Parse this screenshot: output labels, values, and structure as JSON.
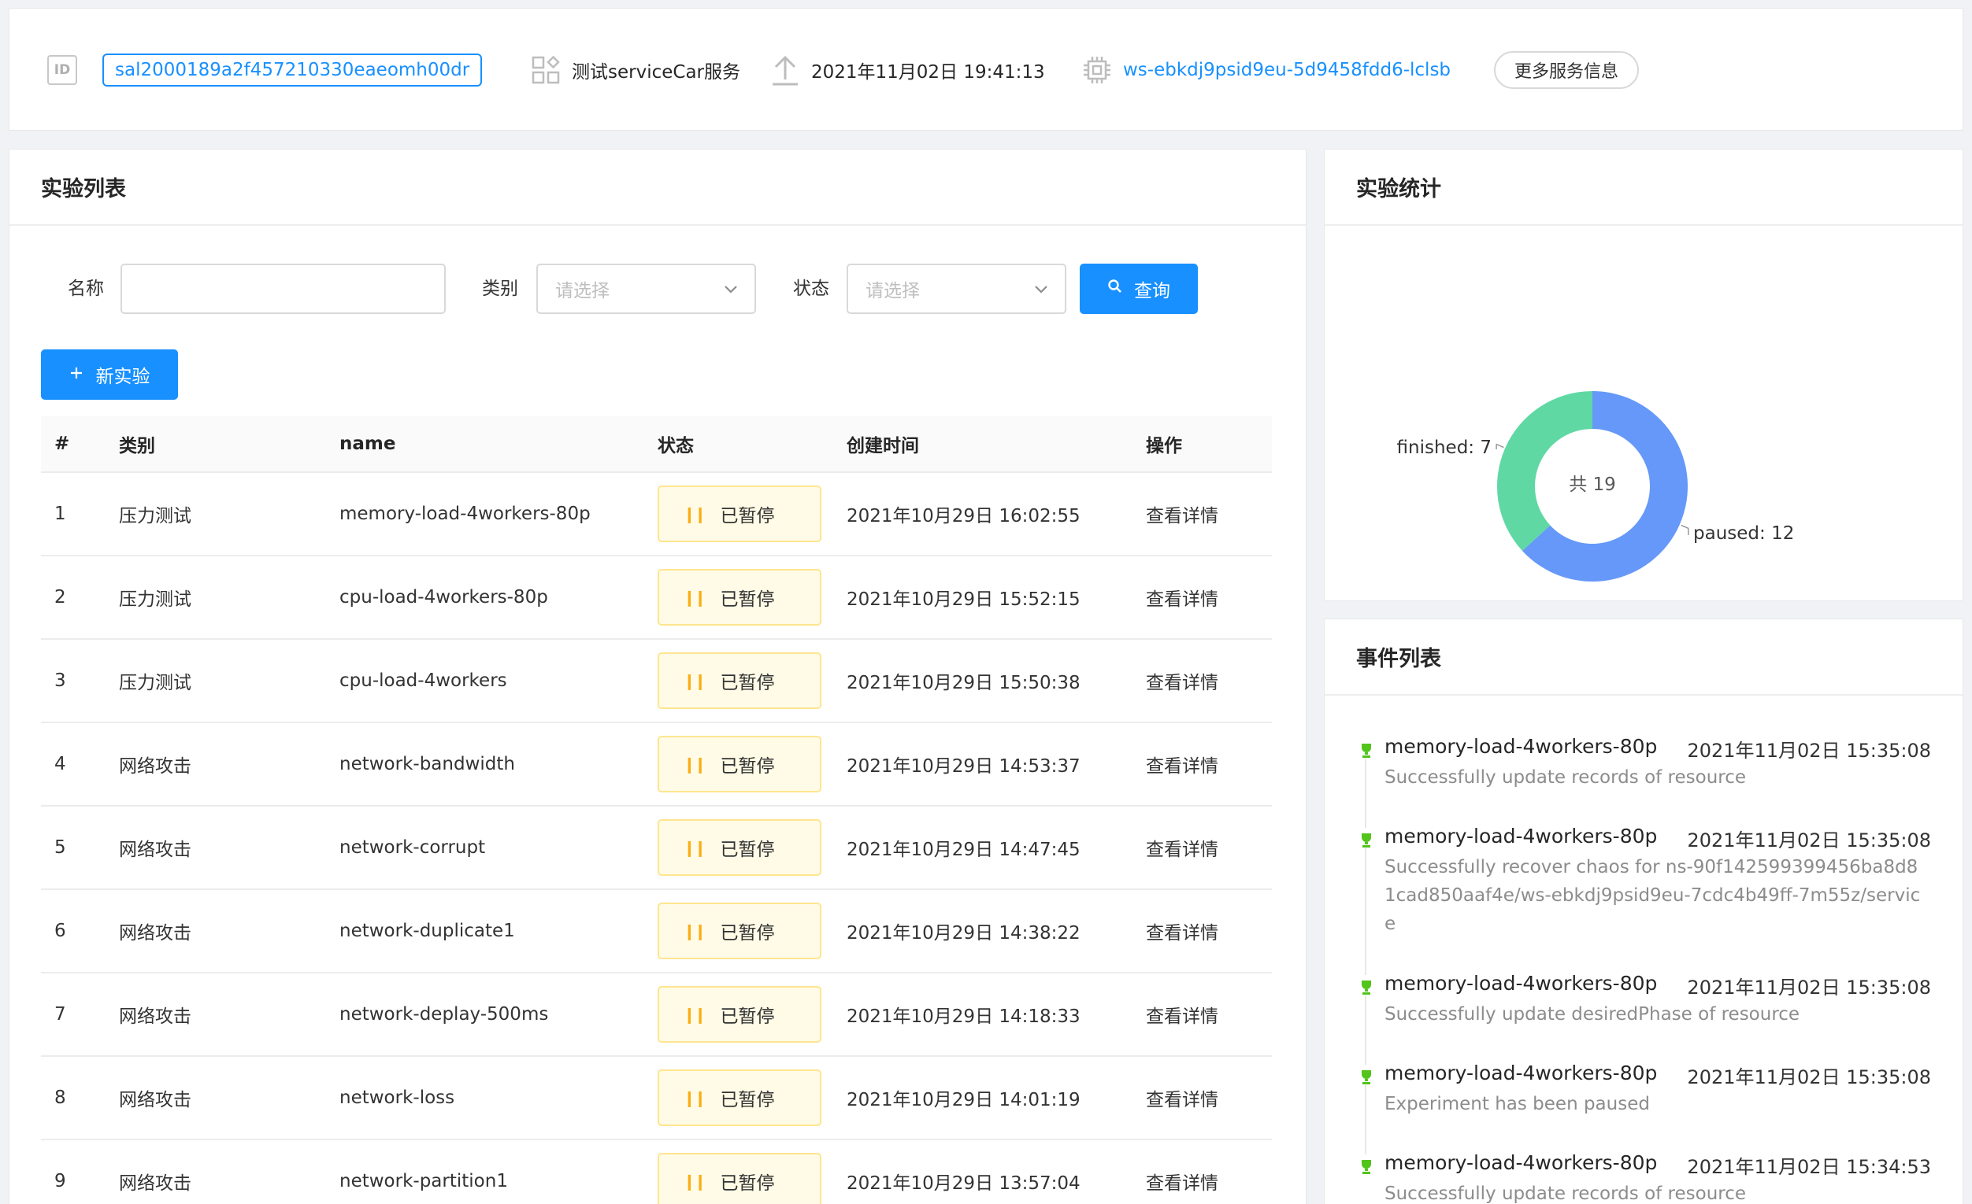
{
  "header": {
    "id_badge": "ID",
    "service_id": "sal2000189a2f457210330eaeomh00dr",
    "service_name": "测试serviceCar服务",
    "upload_time": "2021年11月02日 19:41:13",
    "workspace": "ws-ebkdj9psid9eu-5d9458fdd6-lclsb",
    "more_label": "更多服务信息"
  },
  "experiments": {
    "title": "实验列表",
    "filters": {
      "name_label": "名称",
      "name_value": "",
      "category_label": "类别",
      "category_placeholder": "请选择",
      "status_label": "状态",
      "status_placeholder": "请选择",
      "query_label": "查询"
    },
    "new_label": "新实验",
    "columns": [
      "#",
      "类别",
      "name",
      "状态",
      "创建时间",
      "操作"
    ],
    "rows": [
      {
        "no": "1",
        "category": "压力测试",
        "name": "memory-load-4workers-80p",
        "status": "已暂停",
        "created": "2021年10月29日 16:02:55",
        "action": "查看详情"
      },
      {
        "no": "2",
        "category": "压力测试",
        "name": "cpu-load-4workers-80p",
        "status": "已暂停",
        "created": "2021年10月29日 15:52:15",
        "action": "查看详情"
      },
      {
        "no": "3",
        "category": "压力测试",
        "name": "cpu-load-4workers",
        "status": "已暂停",
        "created": "2021年10月29日 15:50:38",
        "action": "查看详情"
      },
      {
        "no": "4",
        "category": "网络攻击",
        "name": "network-bandwidth",
        "status": "已暂停",
        "created": "2021年10月29日 14:53:37",
        "action": "查看详情"
      },
      {
        "no": "5",
        "category": "网络攻击",
        "name": "network-corrupt",
        "status": "已暂停",
        "created": "2021年10月29日 14:47:45",
        "action": "查看详情"
      },
      {
        "no": "6",
        "category": "网络攻击",
        "name": "network-duplicate1",
        "status": "已暂停",
        "created": "2021年10月29日 14:38:22",
        "action": "查看详情"
      },
      {
        "no": "7",
        "category": "网络攻击",
        "name": "network-deplay-500ms",
        "status": "已暂停",
        "created": "2021年10月29日 14:18:33",
        "action": "查看详情"
      },
      {
        "no": "8",
        "category": "网络攻击",
        "name": "network-loss",
        "status": "已暂停",
        "created": "2021年10月29日 14:01:19",
        "action": "查看详情"
      },
      {
        "no": "9",
        "category": "网络攻击",
        "name": "network-partition1",
        "status": "已暂停",
        "created": "2021年10月29日 13:57:04",
        "action": "查看详情"
      }
    ]
  },
  "stats": {
    "title": "实验统计",
    "total_label": "共 19",
    "finished_label": "finished: 7",
    "paused_label": "paused: 12",
    "colors": {
      "finished": "#5fd8a4",
      "paused": "#6598f8"
    }
  },
  "chart_data": {
    "type": "pie",
    "categories": [
      "finished",
      "paused"
    ],
    "values": [
      7,
      12
    ]
  },
  "events": {
    "title": "事件列表",
    "items": [
      {
        "name": "memory-load-4workers-80p",
        "time": "2021年11月02日 15:35:08",
        "desc": "Successfully update records of resource"
      },
      {
        "name": "memory-load-4workers-80p",
        "time": "2021年11月02日 15:35:08",
        "desc": "Successfully recover chaos for ns-90f142599399456ba8d81cad850aaf4e/ws-ebkdj9psid9eu-7cdc4b49ff-7m55z/service"
      },
      {
        "name": "memory-load-4workers-80p",
        "time": "2021年11月02日 15:35:08",
        "desc": "Successfully update desiredPhase of resource"
      },
      {
        "name": "memory-load-4workers-80p",
        "time": "2021年11月02日 15:35:08",
        "desc": "Experiment has been paused"
      },
      {
        "name": "memory-load-4workers-80p",
        "time": "2021年11月02日 15:34:53",
        "desc": "Successfully update records of resource"
      }
    ]
  }
}
